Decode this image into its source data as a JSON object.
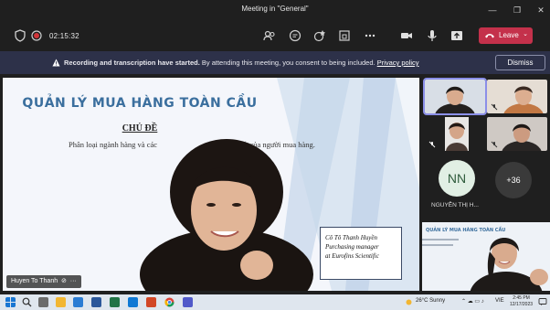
{
  "window": {
    "title": "Meeting in \"General\""
  },
  "toolbar": {
    "timer": "02:15:32",
    "leave_label": "Leave"
  },
  "banner": {
    "bold_text": "Recording and transcription have started.",
    "text": "By attending this meeting, you consent to being included.",
    "link": "Privacy policy",
    "dismiss_label": "Dismiss"
  },
  "slide": {
    "title": "QUẢN LÝ MUA HÀNG TOÀN CẦU",
    "subtitle": "CHỦ ĐỀ",
    "line_left": "Phân loại ngành hàng và các",
    "line_right": "thiết của người mua hàng.",
    "card_lines": [
      "Cô Tô Thanh Huyền",
      "Purchasing manager",
      "at Eurofins Scientific"
    ]
  },
  "presenter": {
    "name": "Huyen To Thanh"
  },
  "participants": {
    "avatar_initials": "NN",
    "more_count": "+36",
    "name_truncated": "NGUYỄN THỊ H..."
  },
  "self_view": {
    "slide_title": "QUẢN LÝ MUA HÀNG TOÀN CẦU"
  },
  "taskbar": {
    "weather": "26°C  Sunny",
    "language": "VIE",
    "time": "2:45 PM",
    "date": "12/17/2023"
  },
  "colors": {
    "leave": "#c4314b",
    "banner": "#2d3149",
    "slide_title": "#3b6f9e",
    "active_tile": "#8b8fe8"
  }
}
